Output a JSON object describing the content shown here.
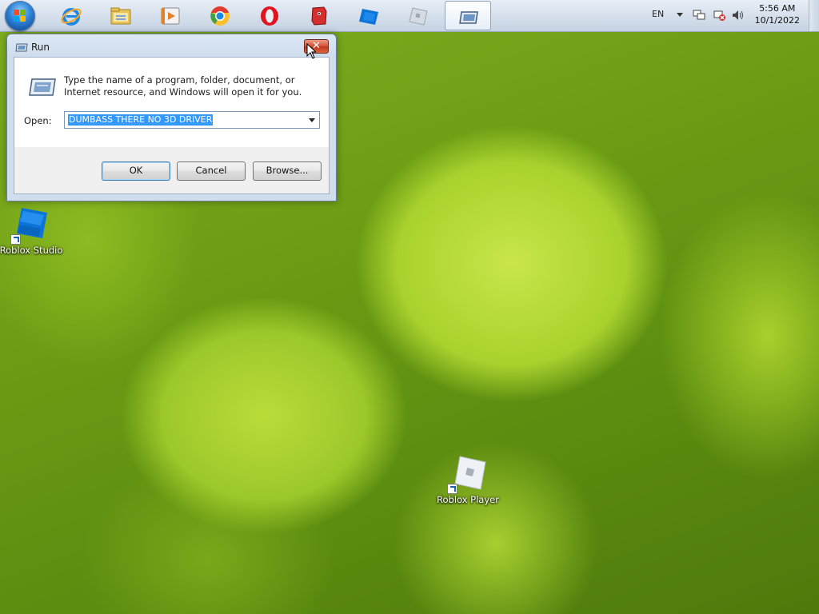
{
  "taskbar": {
    "start_button": "windows-start-orb",
    "pinned": [
      {
        "name": "internet-explorer-icon"
      },
      {
        "name": "file-explorer-icon"
      },
      {
        "name": "media-player-icon"
      },
      {
        "name": "chromium-browser-icon"
      },
      {
        "name": "opera-browser-icon"
      },
      {
        "name": "red-app-icon"
      },
      {
        "name": "roblox-studio-icon"
      },
      {
        "name": "roblox-player-icon"
      },
      {
        "name": "run-icon"
      }
    ],
    "active_item": "run-icon",
    "tray": {
      "language": "EN",
      "time": "5:56 AM",
      "date": "10/1/2022"
    }
  },
  "run_dialog": {
    "title": "Run",
    "close_label": "✕",
    "description": "Type the name of a program, folder, document, or Internet resource, and Windows will open it for you.",
    "open_label": "Open:",
    "open_value": "DUMBASS THERE NO 3D DRIVER",
    "buttons": {
      "ok": "OK",
      "cancel": "Cancel",
      "browse": "Browse..."
    }
  },
  "desktop": {
    "icons": [
      {
        "label": "Roblox Studio"
      },
      {
        "label": "Roblox Player"
      }
    ]
  },
  "colors": {
    "taskbar": "#d6e0ec",
    "close_button": "#c3361b",
    "selection": "#3399ff",
    "wallpaper_main": "#a9d22e"
  }
}
